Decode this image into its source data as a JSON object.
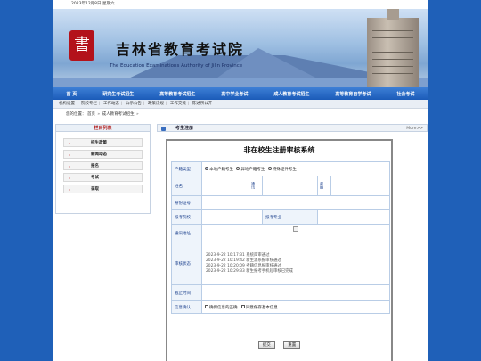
{
  "date_text": "2023年12月8日 星期六",
  "header": {
    "logo_glyph": "書",
    "title": "吉林省教育考试院",
    "subtitle": "The Education Examinations Authority of Jilin Province"
  },
  "nav": [
    "首 页",
    "研究生考试招生",
    "高等教育考试招生",
    "高中学业考试",
    "成人教育考试招生",
    "高等教育自学考试",
    "社会考试"
  ],
  "subnav": [
    "机构设置",
    "院校专栏",
    "工作动态",
    "公示公告",
    "政策法规",
    "工作交流",
    "陈述所公开"
  ],
  "breadcrumb": {
    "prefix": "您的位置：",
    "home": "首页",
    "current": "成人教育考试招生"
  },
  "sidebar": {
    "title": "栏目列表",
    "items": [
      "招生政策",
      "新闻动态",
      "报名",
      "考试",
      "录取"
    ]
  },
  "main": {
    "heading": "考生注册",
    "more": "More>>",
    "panel_title": "非在校生注册审核系统",
    "form": {
      "hukou_label": "户籍类型",
      "hukou_options": [
        "本地户籍考生",
        "异地户籍考生",
        "特殊证件考生"
      ],
      "name_label": "姓名",
      "address_vlabel": "通讯",
      "zip_vlabel": "邮编",
      "id_label": "身份证号",
      "school_label": "报考院校",
      "major_label": "报考专业",
      "addr_label": "通讯地址",
      "status_label": "审核状态",
      "status_lines": [
        "2023-9-22 10:17:31 系统简审通过",
        "2023-9-22 10:19:42 新生源系报审核通过",
        "2023-9-22 10:20:09 考籍信息报审核通过",
        "2023-9-22 10:29:33 新生报考手机短审核已完成"
      ],
      "deadline_label": "截止时间",
      "confirm_label": "信息确认",
      "confirm_options": [
        "确保信息的正确",
        "同意保存基本信息"
      ]
    },
    "buttons": {
      "submit": "提交",
      "reset": "重置"
    }
  },
  "colors": {
    "page_bg": "#1f60b8",
    "nav_bg": "#1b5bb8",
    "seal": "#b3121b"
  }
}
